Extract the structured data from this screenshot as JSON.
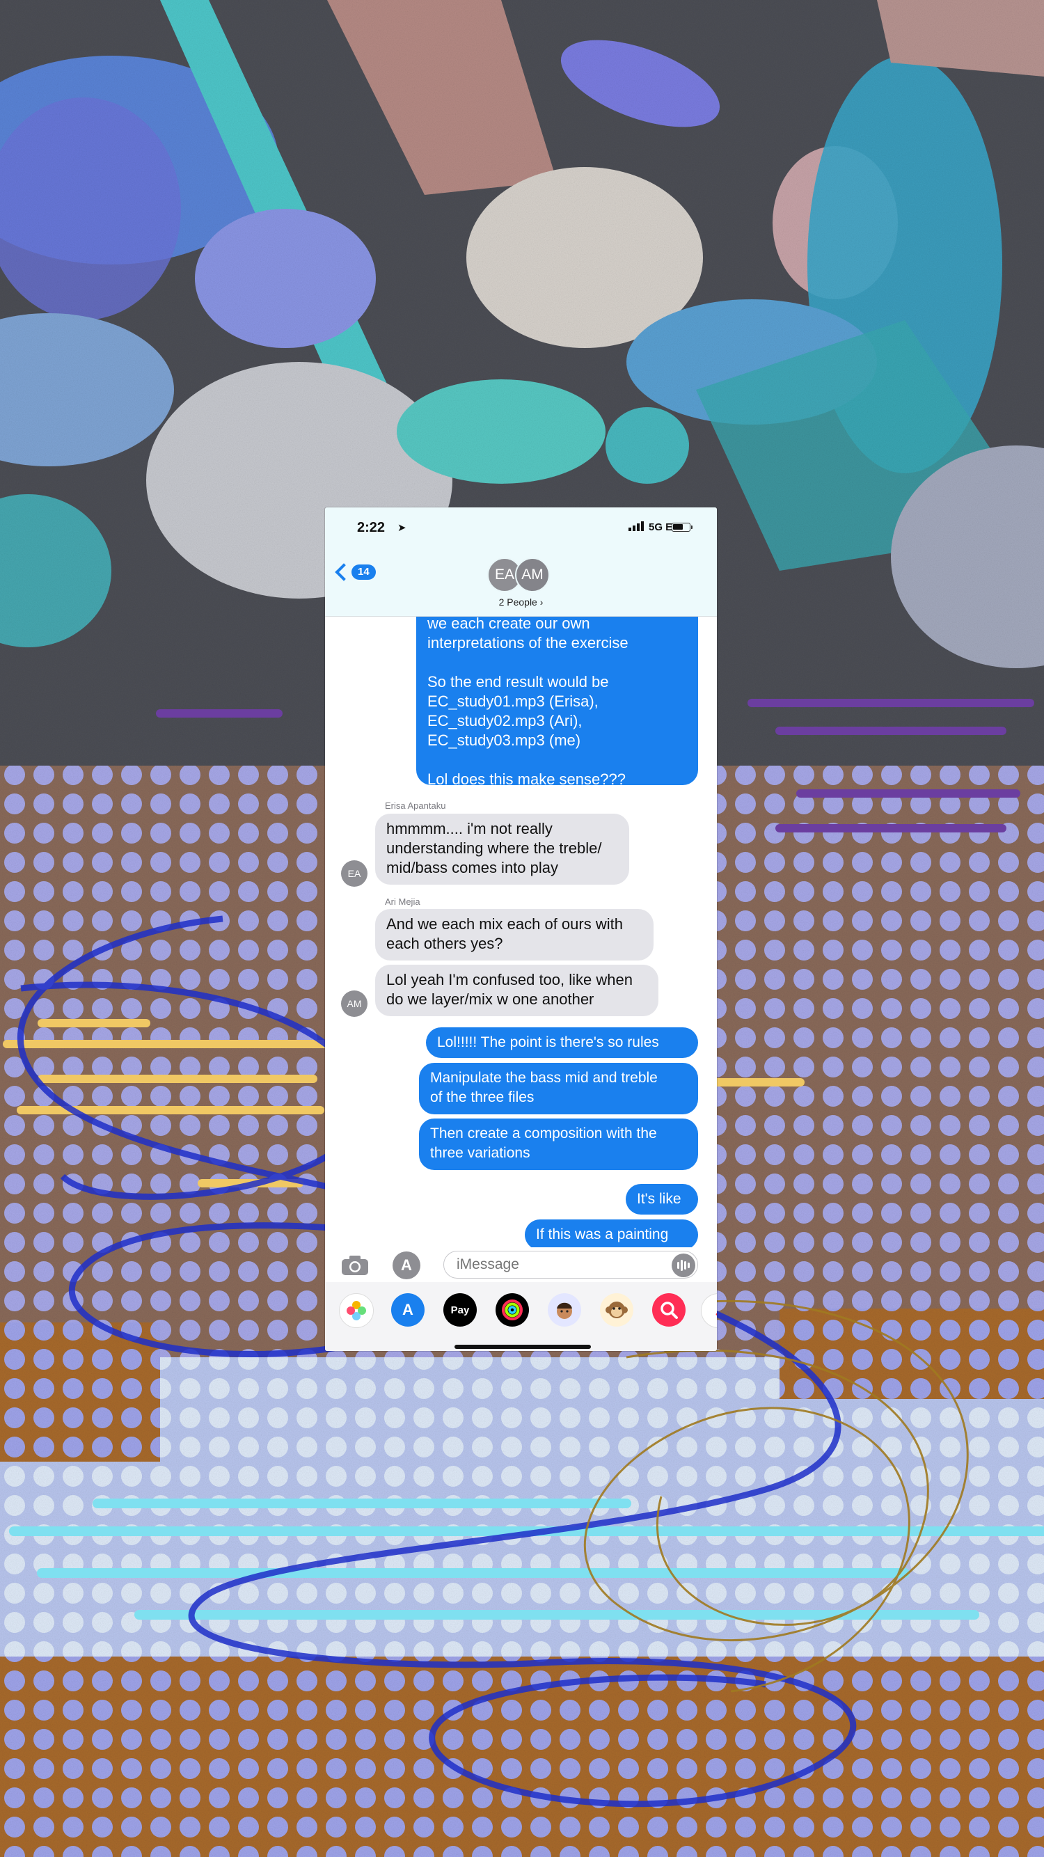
{
  "status_bar": {
    "time": "2:22",
    "network": "5G E"
  },
  "header": {
    "back_count": "14",
    "avatars": [
      "EA",
      "AM"
    ],
    "people_label": "2 People ›"
  },
  "messages": [
    {
      "direction": "outgoing",
      "text": "we each create our own\ninterpretations of the exercise\n\nSo the end result would be\nEC_study01.mp3 (Erisa),\nEC_study02.mp3 (Ari),\nEC_study03.mp3 (me)\n\nLol does this make sense???"
    },
    {
      "direction": "incoming",
      "sender": "Erisa Apantaku",
      "avatar": "EA",
      "text": "hmmmm.... i'm not really\nunderstanding where the treble/\nmid/bass comes into play"
    },
    {
      "direction": "incoming",
      "sender": "Ari Mejia",
      "text": "And we each mix each of ours with\neach others yes?"
    },
    {
      "direction": "incoming",
      "avatar": "AM",
      "text": "Lol yeah I'm confused too, like when\ndo we layer/mix w one another"
    },
    {
      "direction": "outgoing",
      "text": "Lol!!!!! The point is there's so rules"
    },
    {
      "direction": "outgoing",
      "text": "Manipulate the bass mid and treble\nof the three files"
    },
    {
      "direction": "outgoing",
      "text": "Then create a composition with the\nthree variations"
    },
    {
      "direction": "outgoing",
      "text": "It's like"
    },
    {
      "direction": "outgoing",
      "text": "If this was a painting"
    }
  ],
  "input_bar": {
    "placeholder": "iMessage"
  },
  "app_strip": {
    "icons": [
      "photos-icon",
      "app-store-icon",
      "apple-pay-icon",
      "activity-icon",
      "memoji-icon",
      "monkey-icon",
      "search-images-icon",
      "music-icon"
    ],
    "apple_pay_label": "Pay"
  },
  "colors": {
    "outgoing_bubble": "#1a80ee",
    "incoming_bubble": "#e4e4e9",
    "header_bg": "#ecfafc"
  }
}
